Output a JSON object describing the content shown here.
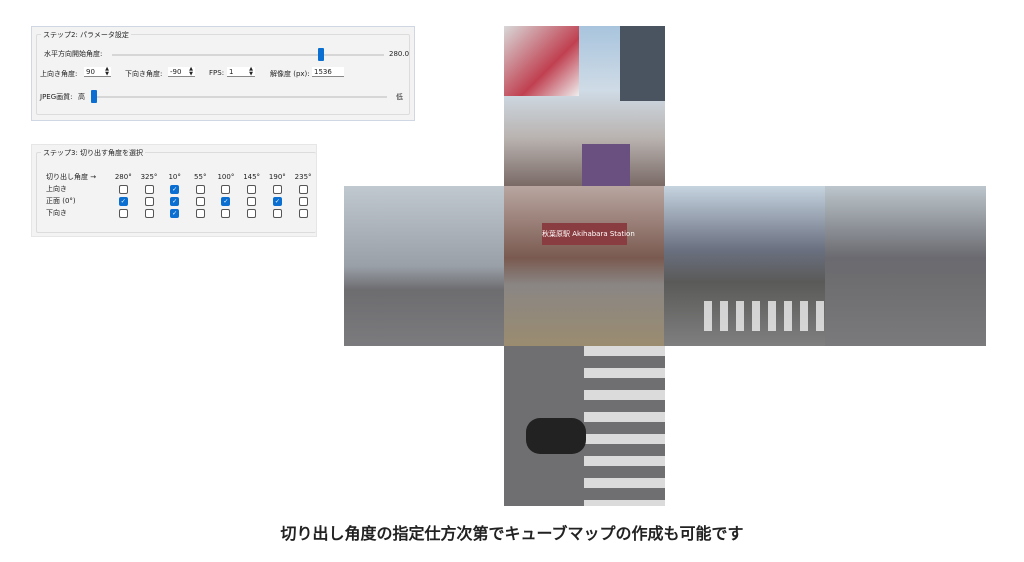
{
  "step2": {
    "title": "ステップ2: パラメータ設定",
    "h_start_label": "水平方向開始角度:",
    "h_start_value": "280.0",
    "h_start_fraction": 0.77,
    "up_label": "上向き角度:",
    "up_value": "90",
    "down_label": "下向き角度:",
    "down_value": "-90",
    "fps_label": "FPS:",
    "fps_value": "1",
    "res_label": "解像度 (px):",
    "res_value": "1536",
    "jpeg_label": "JPEG画質:",
    "jpeg_high": "高",
    "jpeg_low": "低",
    "jpeg_fraction": 0.0
  },
  "step3": {
    "title": "ステップ3: 切り出す角度を選択",
    "header_label": "切り出し角度 →",
    "angles": [
      "280°",
      "325°",
      "10°",
      "55°",
      "100°",
      "145°",
      "190°",
      "235°"
    ],
    "rows": [
      {
        "label": "上向き",
        "checked": [
          0,
          0,
          1,
          0,
          0,
          0,
          0,
          0
        ]
      },
      {
        "label": "正面 (0°)",
        "checked": [
          1,
          0,
          1,
          0,
          1,
          0,
          1,
          0
        ]
      },
      {
        "label": "下向き",
        "checked": [
          0,
          0,
          1,
          0,
          0,
          0,
          0,
          0
        ]
      }
    ]
  },
  "cubemap": {
    "station_sign": "秋葉原駅 Akihabara Station"
  },
  "caption": "切り出し角度の指定仕方次第でキューブマップの作成も可能です"
}
